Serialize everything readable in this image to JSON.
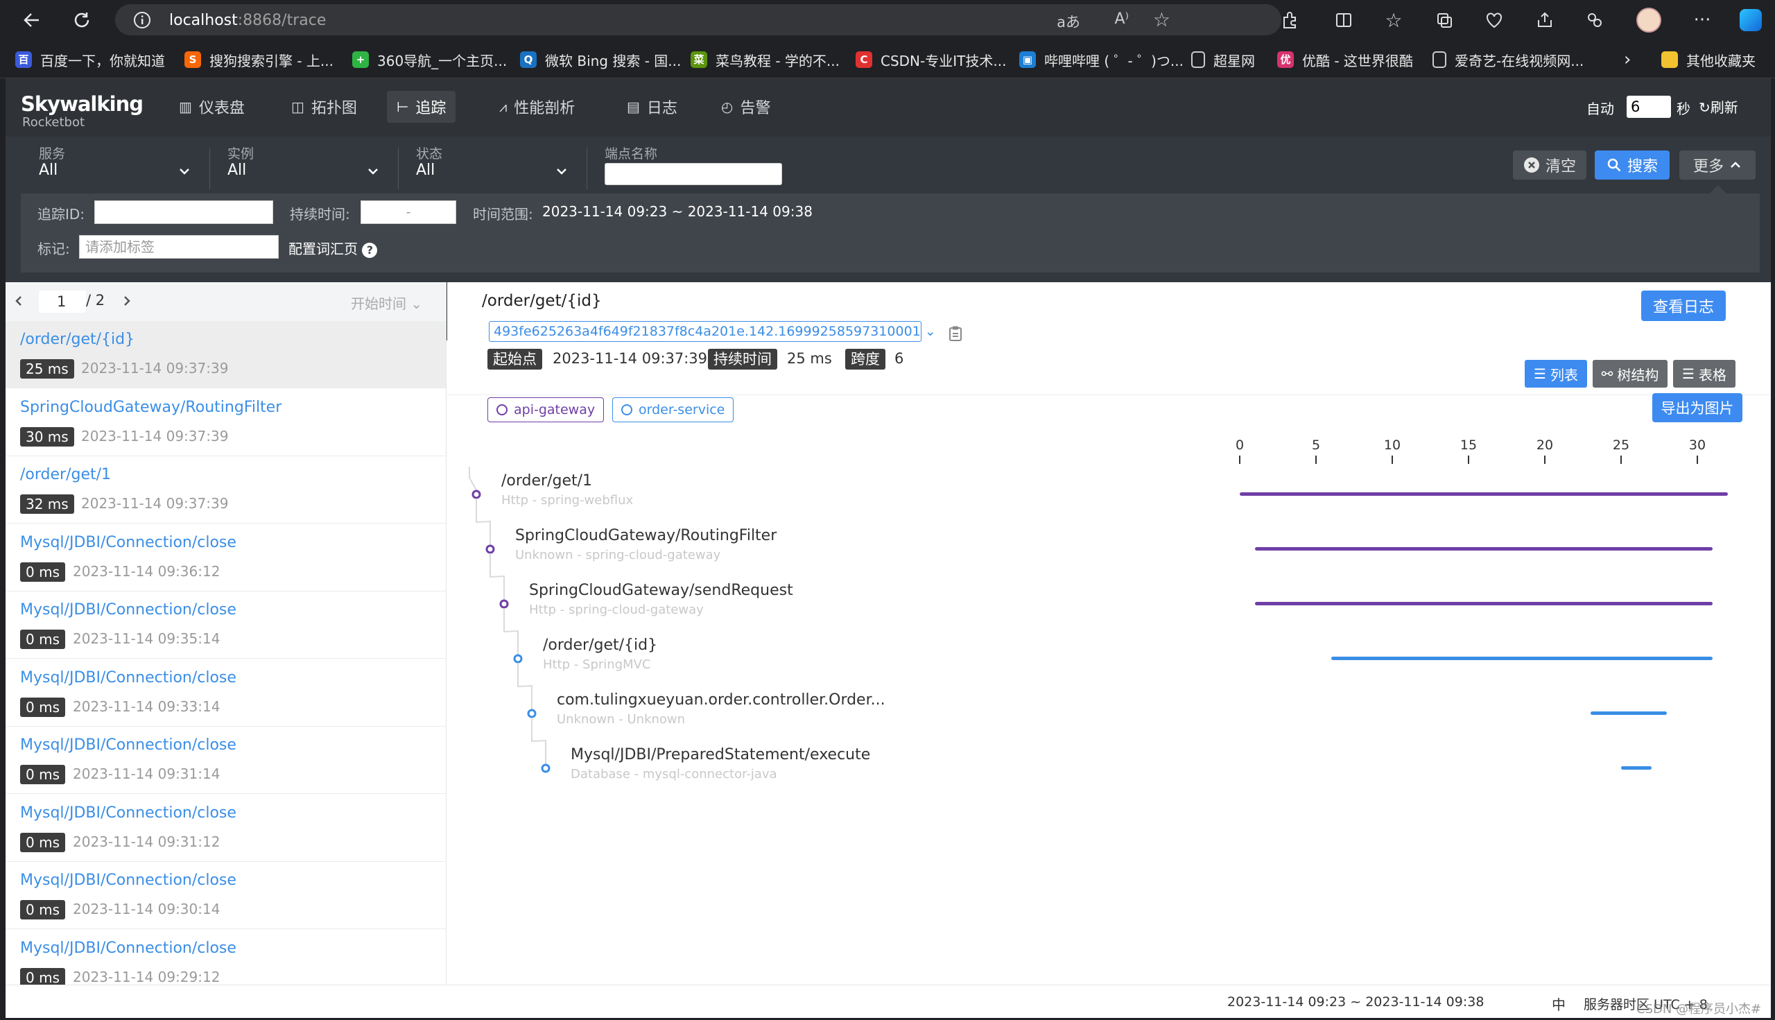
{
  "browser": {
    "url_host": "localhost",
    "url_path": ":8868/trace",
    "bookmarks": [
      {
        "label": "百度一下，你就知道",
        "color": "#3b5bdb"
      },
      {
        "label": "搜狗搜索引擎 - 上...",
        "color": "#f76707"
      },
      {
        "label": "360导航_一个主页...",
        "color": "#2fb344"
      },
      {
        "label": "微软 Bing 搜索 - 国...",
        "color": "#1971c2"
      },
      {
        "label": "菜鸟教程 - 学的不...",
        "color": "#5c940d"
      },
      {
        "label": "CSDN-专业IT技术...",
        "color": "#e03131"
      },
      {
        "label": "哔哩哔哩 ( ゜- ゜)つ...",
        "color": "#1c7ed6"
      },
      {
        "label": "超星网",
        "color": "#868e96"
      },
      {
        "label": "优酷 - 这世界很酷",
        "color": "#d6336c"
      },
      {
        "label": "爱奇艺-在线视频网...",
        "color": "#868e96"
      }
    ],
    "other_bookmarks": "其他收藏夹"
  },
  "app": {
    "logo": "Skywalking",
    "logo_sub": "Rocketbot",
    "nav": [
      {
        "label": "仪表盘",
        "icon": "dashboard-icon"
      },
      {
        "label": "拓扑图",
        "icon": "topology-icon"
      },
      {
        "label": "追踪",
        "icon": "trace-icon"
      },
      {
        "label": "性能剖析",
        "icon": "profile-icon"
      },
      {
        "label": "日志",
        "icon": "log-icon"
      },
      {
        "label": "告警",
        "icon": "alarm-icon"
      }
    ],
    "auto_label": "自动",
    "auto_value": "6",
    "seconds_label": "秒",
    "refresh_label": "刷新"
  },
  "filters": {
    "service": {
      "label": "服务",
      "value": "All"
    },
    "instance": {
      "label": "实例",
      "value": "All"
    },
    "status": {
      "label": "状态",
      "value": "All"
    },
    "endpoint_label": "端点名称",
    "clear": "清空",
    "search": "搜索",
    "more": "更多",
    "trace_id_label": "追踪ID:",
    "duration_label": "持续时间:",
    "duration_sep": "-",
    "time_range_label": "时间范围:",
    "time_range": "2023-11-14 09:23 ~ 2023-11-14 09:38",
    "tag_label": "标记:",
    "tag_placeholder": "请添加标签",
    "vocab_label": "配置词汇页"
  },
  "trace_list": {
    "page": "1",
    "total": "/ 2",
    "sort_label": "开始时间",
    "items": [
      {
        "name": "/order/get/{id}",
        "duration": "25 ms",
        "time": "2023-11-14 09:37:39"
      },
      {
        "name": "SpringCloudGateway/RoutingFilter",
        "duration": "30 ms",
        "time": "2023-11-14 09:37:39"
      },
      {
        "name": "/order/get/1",
        "duration": "32 ms",
        "time": "2023-11-14 09:37:39"
      },
      {
        "name": "Mysql/JDBI/Connection/close",
        "duration": "0 ms",
        "time": "2023-11-14 09:36:12"
      },
      {
        "name": "Mysql/JDBI/Connection/close",
        "duration": "0 ms",
        "time": "2023-11-14 09:35:14"
      },
      {
        "name": "Mysql/JDBI/Connection/close",
        "duration": "0 ms",
        "time": "2023-11-14 09:33:14"
      },
      {
        "name": "Mysql/JDBI/Connection/close",
        "duration": "0 ms",
        "time": "2023-11-14 09:31:14"
      },
      {
        "name": "Mysql/JDBI/Connection/close",
        "duration": "0 ms",
        "time": "2023-11-14 09:31:12"
      },
      {
        "name": "Mysql/JDBI/Connection/close",
        "duration": "0 ms",
        "time": "2023-11-14 09:30:14"
      },
      {
        "name": "Mysql/JDBI/Connection/close",
        "duration": "0 ms",
        "time": "2023-11-14 09:29:12"
      }
    ]
  },
  "detail": {
    "title": "/order/get/{id}",
    "view_logs": "查看日志",
    "trace_id": "493fe625263a4f649f21837f8c4a201e.142.16999258597310001",
    "start_label": "起始点",
    "start_value": "2023-11-14 09:37:39",
    "duration_label": "持续时间",
    "duration_value": "25 ms",
    "spans_label": "跨度",
    "spans_value": "6",
    "view_list": "列表",
    "view_tree": "树结构",
    "view_table": "表格",
    "export": "导出为图片",
    "services": [
      {
        "name": "api-gateway",
        "color": "#6f3ea6"
      },
      {
        "name": "order-service",
        "color": "#3a8ee6"
      }
    ],
    "axis_ticks": [
      "0",
      "5",
      "10",
      "15",
      "20",
      "25",
      "30"
    ],
    "spans": [
      {
        "name": "/order/get/1",
        "sub": "Http - spring-webflux",
        "start": 0,
        "end": 32,
        "color": "#6f3ea6"
      },
      {
        "name": "SpringCloudGateway/RoutingFilter",
        "sub": "Unknown - spring-cloud-gateway",
        "start": 1,
        "end": 31,
        "color": "#6f3ea6"
      },
      {
        "name": "SpringCloudGateway/sendRequest",
        "sub": "Http - spring-cloud-gateway",
        "start": 1,
        "end": 31,
        "color": "#6f3ea6"
      },
      {
        "name": "/order/get/{id}",
        "sub": "Http - SpringMVC",
        "start": 6,
        "end": 31,
        "color": "#3a8ee6"
      },
      {
        "name": "com.tulingxueyuan.order.controller.Order...",
        "sub": "Unknown - Unknown",
        "start": 23,
        "end": 28,
        "color": "#3a8ee6"
      },
      {
        "name": "Mysql/JDBI/PreparedStatement/execute",
        "sub": "Database - mysql-connector-java",
        "start": 25,
        "end": 27,
        "color": "#3a8ee6"
      }
    ]
  },
  "footer": {
    "time_range": "2023-11-14 09:23 ~ 2023-11-14 09:38",
    "lang": "中",
    "timezone": "服务器时区 UTC + 8",
    "watermark": "CSDN @程序员小杰#"
  }
}
